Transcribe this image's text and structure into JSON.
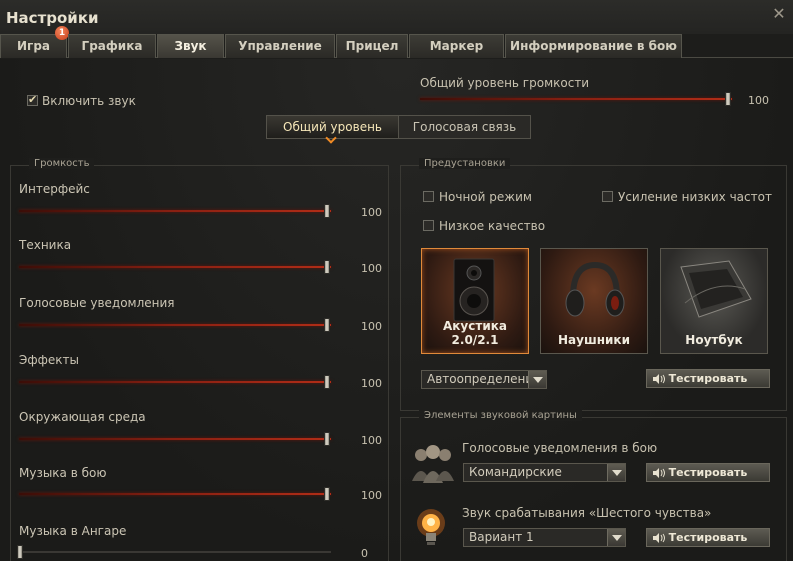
{
  "window": {
    "title": "Настройки",
    "close_glyph": "✕"
  },
  "tabs": [
    {
      "label": "Игра",
      "badge": "1"
    },
    {
      "label": "Графика"
    },
    {
      "label": "Звук",
      "active": true
    },
    {
      "label": "Управление"
    },
    {
      "label": "Прицел"
    },
    {
      "label": "Маркер"
    },
    {
      "label": "Информирование в бою"
    }
  ],
  "general": {
    "enable_sound_label": "Включить звук",
    "enable_sound_checked": true,
    "master_volume_label": "Общий уровень громкости",
    "master_volume_value": "100",
    "master_volume_level": 1.0
  },
  "mode_toggle": {
    "options": [
      "Общий уровень",
      "Голосовая связь"
    ],
    "selected": "Общий уровень"
  },
  "volume": {
    "legend": "Громкость",
    "items": [
      {
        "label": "Интерфейс",
        "value": "100",
        "level": 1.0
      },
      {
        "label": "Техника",
        "value": "100",
        "level": 1.0
      },
      {
        "label": "Голосовые уведомления",
        "value": "100",
        "level": 1.0
      },
      {
        "label": "Эффекты",
        "value": "100",
        "level": 1.0
      },
      {
        "label": "Окружающая среда",
        "value": "100",
        "level": 1.0
      },
      {
        "label": "Музыка в бою",
        "value": "100",
        "level": 1.0
      },
      {
        "label": "Музыка в Ангаре",
        "value": "0",
        "level": 0.0
      }
    ]
  },
  "presets": {
    "legend": "Предустановки",
    "night_mode": "Ночной режим",
    "bass_boost": "Усиление низких частот",
    "low_quality": "Низкое качество",
    "devices": [
      {
        "label": "Акустика 2.0/2.1",
        "icon": "speaker-icon",
        "selected": true
      },
      {
        "label": "Наушники",
        "icon": "headphones-icon"
      },
      {
        "label": "Ноутбук",
        "icon": "laptop-icon"
      }
    ],
    "detect_select": "Автоопределение",
    "test_button": "Тестировать"
  },
  "sound_elements": {
    "legend": "Элементы звуковой картины",
    "voice_label": "Голосовые уведомления в бою",
    "voice_select": "Командирские",
    "sixth_sense_label": "Звук срабатывания «Шестого чувства»",
    "sixth_sense_select": "Вариант 1",
    "test_button": "Тестировать"
  },
  "colors": {
    "accent": "#f08a24",
    "slider_fill": "#b22d17",
    "selected_card": "#e08a3a"
  }
}
